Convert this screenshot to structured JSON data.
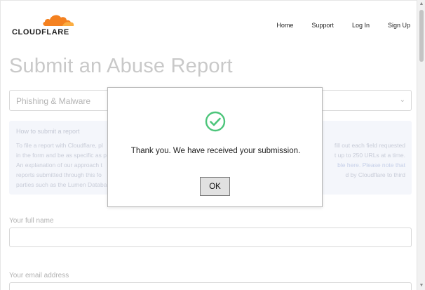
{
  "header": {
    "logo_text": "CLOUDFLARE",
    "brand_color": "#F48120",
    "nav": [
      {
        "label": "Home"
      },
      {
        "label": "Support"
      },
      {
        "label": "Log In"
      },
      {
        "label": "Sign Up"
      }
    ]
  },
  "main": {
    "title": "Submit an Abuse Report",
    "report_type": {
      "value": "Phishing & Malware",
      "icon": "chevron-down-icon"
    },
    "info": {
      "heading": "How to submit a report",
      "lines": [
        "To file a report with Cloudflare, pl",
        "in the form and be as specific as p",
        "An explanation of our approach t",
        "reports submitted through this fo",
        "parties such as the Lumen Databa"
      ],
      "lines_right": [
        "fill out each field requested",
        "t up to 250 URLs at a time.",
        "ble here. Please note that",
        "d by Cloudflare to third",
        ""
      ]
    },
    "fields": [
      {
        "label": "Your full name",
        "value": ""
      },
      {
        "label": "Your email address",
        "value": ""
      }
    ]
  },
  "dialog": {
    "icon": "check-circle-icon",
    "icon_color": "#4CC57A",
    "message": "Thank you. We have received your submission.",
    "ok_label": "OK"
  }
}
